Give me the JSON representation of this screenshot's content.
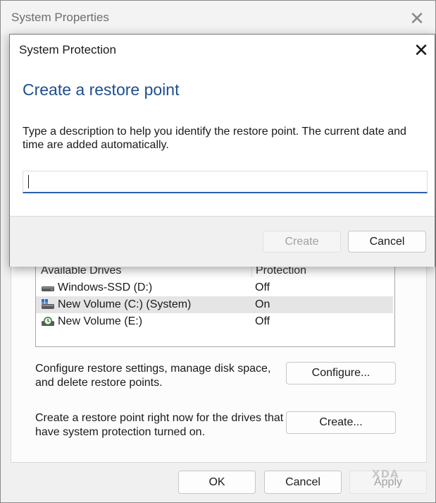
{
  "system_properties": {
    "title": "System Properties",
    "close_glyph": "✕",
    "drives": {
      "headers": {
        "drive": "Available Drives",
        "protection": "Protection"
      },
      "rows": [
        {
          "name": "Windows-SSD (D:)",
          "protection": "Off",
          "icon": "drive-icon",
          "selected": false
        },
        {
          "name": "New Volume (C:) (System)",
          "protection": "On",
          "icon": "system-drive-icon",
          "selected": true
        },
        {
          "name": "New Volume (E:)",
          "protection": "Off",
          "icon": "backup-drive-icon",
          "selected": false
        }
      ]
    },
    "configure_text_1": "Configure restore settings, manage disk space,",
    "configure_text_2": "and delete restore points.",
    "configure_button": "Configure...",
    "create_text_1": "Create a restore point right now for the drives that",
    "create_text_2": "have system protection turned on.",
    "create_button": "Create...",
    "ok_button": "OK",
    "cancel_button": "Cancel",
    "apply_button": "Apply",
    "watermark": "XDA"
  },
  "dialog": {
    "title": "System Protection",
    "close_glyph": "✕",
    "heading": "Create a restore point",
    "description": "Type a description to help you identify the restore point. The current date and time are added automatically.",
    "input_value": "",
    "create_button": "Create",
    "cancel_button": "Cancel"
  },
  "colors": {
    "heading_blue": "#1f4e8c",
    "input_focus_underline": "#2c5fa8",
    "selected_row": "#e5e5e5"
  }
}
